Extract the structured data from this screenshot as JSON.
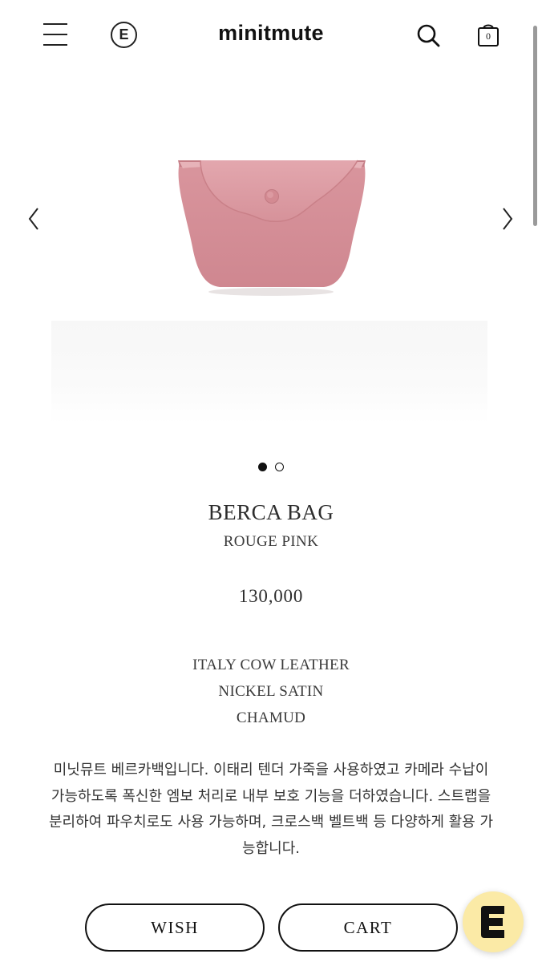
{
  "header": {
    "menu_icon": "hamburger-menu-icon",
    "badge_letter": "E",
    "logo": "minitmute",
    "search_icon": "search-icon",
    "cart_icon": "shopping-bag-icon",
    "cart_count": "0"
  },
  "carousel": {
    "prev_icon": "chevron-left-icon",
    "next_icon": "chevron-right-icon",
    "slide_count": 2,
    "active_slide": 1,
    "product_image": "pink-leather-pouch-bag"
  },
  "product": {
    "name": "BERCA BAG",
    "color": "ROUGE PINK",
    "price": "130,000",
    "materials": [
      "ITALY COW LEATHER",
      "NICKEL SATIN",
      "CHAMUD"
    ],
    "description": "미닛뮤트 베르카백입니다. 이태리 텐더 가죽을 사용하였고 카메라 수납이 가능하도록 폭신한 엠보 처리로 내부 보호 기능을 더하였습니다. 스트랩을 분리하여 파우치로도 사용 가능하며, 크로스백 벨트백 등 다양하게 활용 가능합니다."
  },
  "actions": {
    "wish_label": "WISH",
    "cart_label": "CART"
  },
  "floating_button": {
    "icon": "e-logo-icon",
    "color": "#fbeaa6"
  },
  "colors": {
    "bag_pink": "#d9949c",
    "text": "#2a2a2a",
    "background": "#ffffff"
  }
}
